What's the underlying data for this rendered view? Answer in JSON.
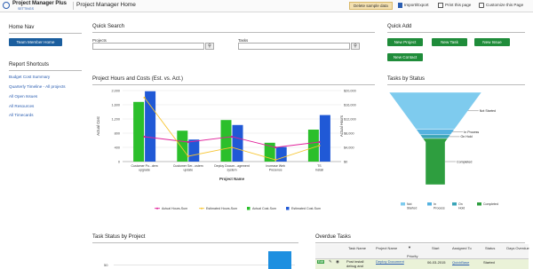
{
  "header": {
    "app_name": "Project Manager Plus",
    "settings_label": "SETTINGS",
    "page_title": "Project Manager Home",
    "delete_sample_label": "Delete sample data",
    "import_export_label": "Import/Export",
    "print_label": "Print this page",
    "customize_label": "Customize this Page"
  },
  "home_nav": {
    "title": "Home Nav",
    "team_button": "Team Member Home"
  },
  "reports": {
    "title": "Report Shortcuts",
    "items": [
      "Budget Cost Summary",
      "Quarterly Timeline - All projects",
      "All Open Issues",
      "All Resources",
      "All Timecards"
    ]
  },
  "quick_search": {
    "title": "Quick Search",
    "projects_label": "Projects",
    "tasks_label": "Tasks"
  },
  "quick_add": {
    "title": "Quick Add",
    "new_project": "New Project",
    "new_task": "New Task",
    "new_issue": "New Issue",
    "new_contact": "New Contact"
  },
  "hours_chart": {
    "title": "Project Hours and Costs (Est. vs. Act.)",
    "left_axis_title": "Actual Cost",
    "right_axis_title": "Actual Hours",
    "x_axis_title": "Project Name",
    "legend": [
      "Actual Hours-Sum",
      "Estimated Hours-Sum",
      "Actual Cost-Sum",
      "Estimated Cost-Sum"
    ],
    "colors": [
      "#e0219a",
      "#f7c531",
      "#2bbf2b",
      "#2059d6"
    ]
  },
  "status_chart": {
    "title": "Tasks by Status",
    "legend": [
      "Not Started",
      "In Process",
      "On Hold",
      "Completed"
    ],
    "colors": [
      "#7ecbee",
      "#55b2e0",
      "#3aa5b8",
      "#2e9e3f"
    ]
  },
  "task_status_title": "Task Status by Project",
  "task_status_ytick": "50",
  "overdue": {
    "title": "Overdue Tasks",
    "headers": [
      "Task Name",
      "Project Name",
      "Priority",
      "Start",
      "Assigned To",
      "Status",
      "Days Overdue"
    ],
    "row": {
      "badge": "Edit",
      "task": "Post install debug and",
      "project": "Deploy Document",
      "start": "06-03-2015",
      "assigned": "QuickBase",
      "status": "Started"
    }
  },
  "chart_data": [
    {
      "type": "bar",
      "title": "Project Hours and Costs (Est. vs. Act.)",
      "xlabel": "Project Name",
      "ylabel": "Actual Cost",
      "y2label": "Actual Hours",
      "categories": [
        "Customer Po...dem upgrade",
        "Customer Ser...ostem update",
        "Deploy Docum...agement system",
        "Increase Web Presence",
        "TS Install"
      ],
      "left_ticks": [
        "2,000",
        "1,600",
        "1,200",
        "800",
        "400",
        "0"
      ],
      "right_ticks": [
        "$20,000",
        "$16,000",
        "$12,000",
        "$8,000",
        "$4,000",
        "$0"
      ],
      "left_axis_range": [
        0,
        2000
      ],
      "right_axis_range": [
        0,
        20000
      ],
      "series": [
        {
          "name": "Actual Hours-Sum",
          "type": "line",
          "values": [
            700,
            550,
            700,
            400,
            550
          ]
        },
        {
          "name": "Estimated Hours-Sum",
          "type": "line",
          "values": [
            1800,
            150,
            400,
            50,
            450
          ]
        },
        {
          "name": "Actual Cost-Sum",
          "type": "bar",
          "values": [
            16800,
            8700,
            11700,
            5300,
            9000
          ]
        },
        {
          "name": "Estimated Cost-Sum",
          "type": "bar",
          "values": [
            19800,
            6200,
            10300,
            4100,
            13100
          ]
        }
      ],
      "grid": true,
      "legend_position": "bottom"
    },
    {
      "type": "funnel",
      "title": "Tasks by Status",
      "categories": [
        "Not Started",
        "In Process",
        "On Hold",
        "Completed"
      ],
      "values": [
        40,
        6,
        4,
        50
      ]
    }
  ]
}
